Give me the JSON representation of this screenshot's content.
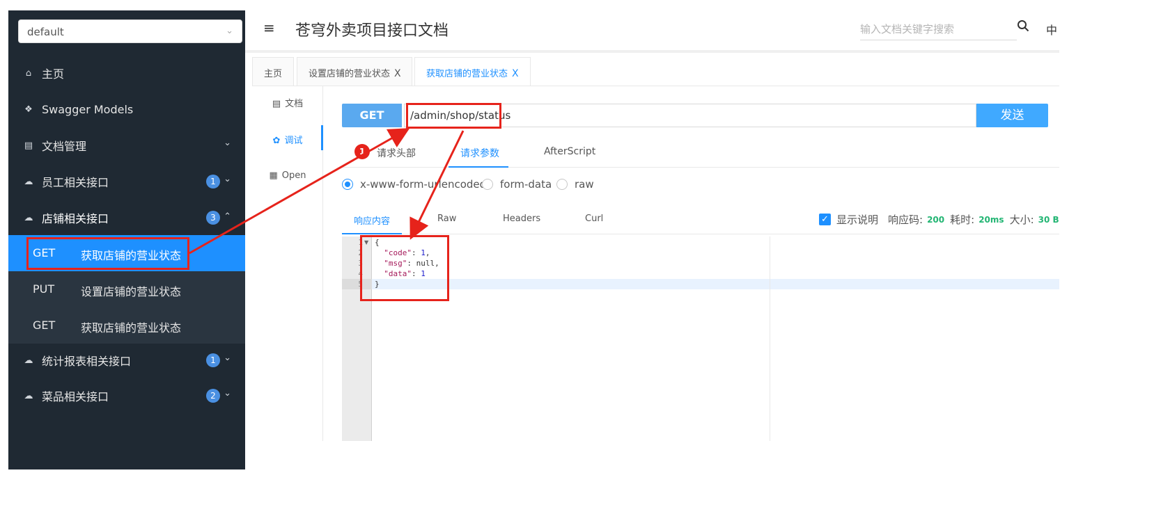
{
  "sidebar": {
    "group_select": "default",
    "items": [
      {
        "label": "主页",
        "icon": "home-icon"
      },
      {
        "label": "Swagger Models",
        "icon": "cube-icon"
      },
      {
        "label": "文档管理",
        "icon": "document-settings-icon"
      },
      {
        "label": "员工相关接口",
        "icon": "cloud-icon",
        "badge": "1"
      },
      {
        "label": "店铺相关接口",
        "icon": "cloud-icon",
        "badge": "3"
      },
      {
        "label": "统计报表相关接口",
        "icon": "cloud-icon",
        "badge": "1"
      },
      {
        "label": "菜品相关接口",
        "icon": "cloud-icon",
        "badge": "2"
      }
    ],
    "shop_endpoints": [
      {
        "method": "GET",
        "name": "获取店铺的营业状态"
      },
      {
        "method": "PUT",
        "name": "设置店铺的营业状态"
      },
      {
        "method": "GET",
        "name": "获取店铺的营业状态"
      }
    ]
  },
  "header": {
    "title": "苍穹外卖项目接口文档",
    "search_placeholder": "输入文档关键字搜索",
    "lang": "中"
  },
  "tabs": [
    {
      "label": "主页"
    },
    {
      "label": "设置店铺的营业状态",
      "close": "X"
    },
    {
      "label": "获取店铺的营业状态",
      "close": "X"
    }
  ],
  "vnav": {
    "items": [
      {
        "label": "文档",
        "icon": "document-icon"
      },
      {
        "label": "调试",
        "icon": "bug-icon"
      },
      {
        "label": "Open",
        "icon": "file-icon"
      }
    ]
  },
  "request": {
    "method": "GET",
    "url": "/admin/shop/status",
    "send": "发送"
  },
  "param_tabs": [
    "请求头部",
    "请求参数",
    "AfterScript"
  ],
  "content_types": [
    "x-www-form-urlencoded",
    "form-data",
    "raw"
  ],
  "response": {
    "tabs": [
      "响应内容",
      "Raw",
      "Headers",
      "Curl"
    ],
    "show_desc": "显示说明",
    "code_label": "响应码:",
    "code_value": "200",
    "time_label": "耗时:",
    "time_value": "20ms",
    "size_label": "大小:",
    "size_value": "30 B",
    "line_numbers": [
      "1",
      "2",
      "3",
      "4",
      "5"
    ],
    "code": {
      "open": "{",
      "k1": "\"code\"",
      "v1": "1",
      "k2": "\"msg\"",
      "v2": "null",
      "k3": "\"data\"",
      "v3": "1",
      "close": "}"
    }
  },
  "annotation": {
    "badge": "1",
    "color": "#e6231b"
  },
  "colors": {
    "accent": "#1e90ff",
    "sidebar_bg": "#1f2933",
    "success": "#22b573"
  }
}
